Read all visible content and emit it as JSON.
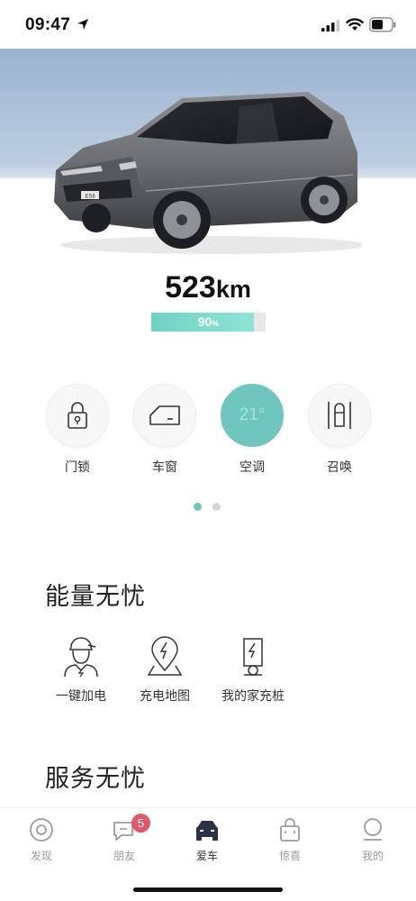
{
  "status_bar": {
    "time": "09:47"
  },
  "vehicle": {
    "model_badge": "ES8",
    "range_value": "523",
    "range_unit": "km",
    "battery_percent": 90,
    "battery_number": "90",
    "battery_unit": "%"
  },
  "controls": [
    {
      "label": "门锁",
      "icon": "lock-icon"
    },
    {
      "label": "车窗",
      "icon": "window-icon"
    },
    {
      "label": "空调",
      "icon": "ac-temperature",
      "value": "21°",
      "active": true
    },
    {
      "label": "召唤",
      "icon": "summon-icon"
    }
  ],
  "pager": {
    "pages": 2,
    "current": 1
  },
  "energy_section": {
    "title": "能量无忧",
    "items": [
      {
        "label": "一键加电",
        "icon": "power-service-icon"
      },
      {
        "label": "充电地图",
        "icon": "charging-map-icon"
      },
      {
        "label": "我的家充桩",
        "icon": "home-charger-icon"
      }
    ]
  },
  "service_section": {
    "title": "服务无忧"
  },
  "tabbar": {
    "items": [
      {
        "label": "发现",
        "icon": "discover-icon"
      },
      {
        "label": "朋友",
        "icon": "chat-icon",
        "badge": "5"
      },
      {
        "label": "爱车",
        "icon": "car-icon",
        "active": true
      },
      {
        "label": "惊喜",
        "icon": "shopping-bag-icon"
      },
      {
        "label": "我的",
        "icon": "profile-icon"
      }
    ]
  },
  "colors": {
    "accent_teal": "#6ec6bf",
    "battery_fill": "#7ddacb",
    "badge_red": "#e0596a",
    "tab_active": "#2c3148",
    "tab_inactive": "#9a9aa5"
  }
}
